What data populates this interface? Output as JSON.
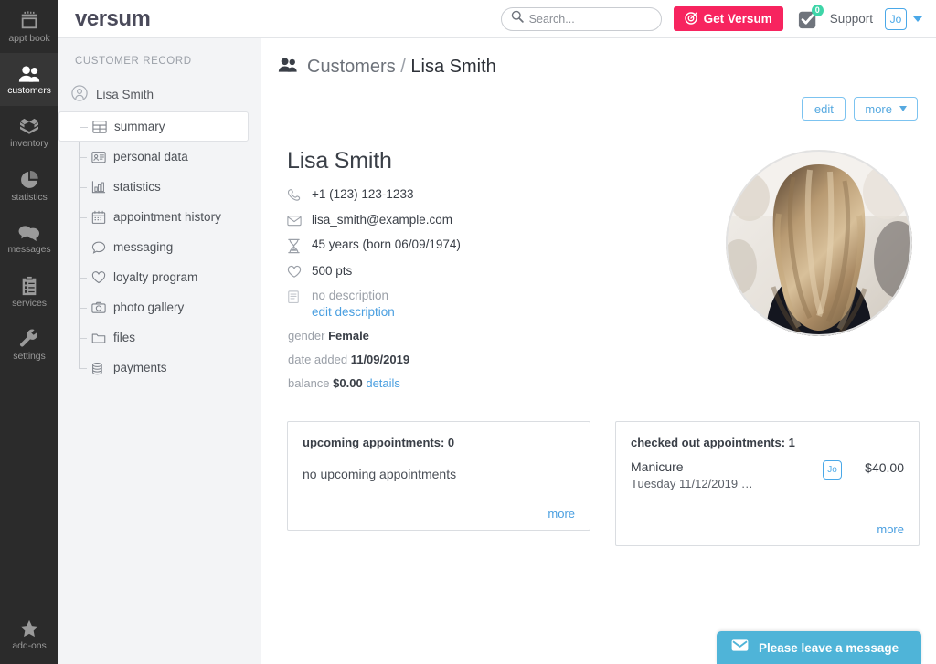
{
  "leftnav": {
    "items": [
      {
        "label": "appt book",
        "icon": "calendar-icon",
        "active": false
      },
      {
        "label": "customers",
        "icon": "people-icon",
        "active": true
      },
      {
        "label": "inventory",
        "icon": "box-icon",
        "active": false
      },
      {
        "label": "statistics",
        "icon": "pie-chart-icon",
        "active": false
      },
      {
        "label": "messages",
        "icon": "chat-icon",
        "active": false
      },
      {
        "label": "services",
        "icon": "clipboard-icon",
        "active": false
      },
      {
        "label": "settings",
        "icon": "wrench-icon",
        "active": false
      }
    ],
    "bottom": {
      "label": "add-ons",
      "icon": "star-icon"
    }
  },
  "header": {
    "logo": "versum",
    "search": {
      "placeholder": "Search...",
      "value": ""
    },
    "get_versum_label": "Get Versum",
    "notification_count": "0",
    "support_label": "Support",
    "user_initials": "Jo"
  },
  "record_sidebar": {
    "title": "CUSTOMER RECORD",
    "customer_name": "Lisa Smith",
    "items": [
      {
        "label": "summary",
        "icon": "table-icon",
        "active": true
      },
      {
        "label": "personal data",
        "icon": "id-card-icon",
        "active": false
      },
      {
        "label": "statistics",
        "icon": "bar-chart-icon",
        "active": false
      },
      {
        "label": "appointment history",
        "icon": "calendar-icon",
        "active": false
      },
      {
        "label": "messaging",
        "icon": "speech-bubble-icon",
        "active": false
      },
      {
        "label": "loyalty program",
        "icon": "heart-icon",
        "active": false
      },
      {
        "label": "photo gallery",
        "icon": "camera-icon",
        "active": false
      },
      {
        "label": "files",
        "icon": "folder-icon",
        "active": false
      },
      {
        "label": "payments",
        "icon": "coins-icon",
        "active": false
      }
    ]
  },
  "main": {
    "breadcrumb": {
      "section": "Customers",
      "separator": "/",
      "current": "Lisa Smith"
    },
    "actions": {
      "edit_label": "edit",
      "more_label": "more"
    },
    "profile": {
      "name": "Lisa Smith",
      "phone": "+1 (123) 123-1233",
      "email": "lisa_smith@example.com",
      "age": "45 years (born 06/09/1974)",
      "points": "500 pts",
      "description": "no description",
      "edit_description_label": "edit description",
      "gender_label": "gender",
      "gender_value": "Female",
      "date_added_label": "date added",
      "date_added_value": "11/09/2019",
      "balance_label": "balance",
      "balance_value": "$0.00",
      "balance_details_label": "details"
    },
    "cards": {
      "upcoming": {
        "title": "upcoming appointments: 0",
        "empty_text": "no upcoming appointments",
        "more_label": "more"
      },
      "checked_out": {
        "title": "checked out appointments: 1",
        "more_label": "more",
        "appointments": [
          {
            "service": "Manicure",
            "date": "Tuesday 11/12/2019 …",
            "staff_initials": "Jo",
            "price": "$40.00"
          }
        ]
      }
    }
  },
  "chat_widget": {
    "label": "Please leave a message",
    "icon": "envelope-icon"
  },
  "colors": {
    "nav_bg": "#2b2b2b",
    "nav_active_bg": "#363636",
    "accent_pink": "#f7245f",
    "accent_blue": "#4a9fe0",
    "sidebar_bg": "#f3f4f6",
    "chat_blue": "#4fb4d8",
    "badge_green": "#3ed5a8"
  }
}
